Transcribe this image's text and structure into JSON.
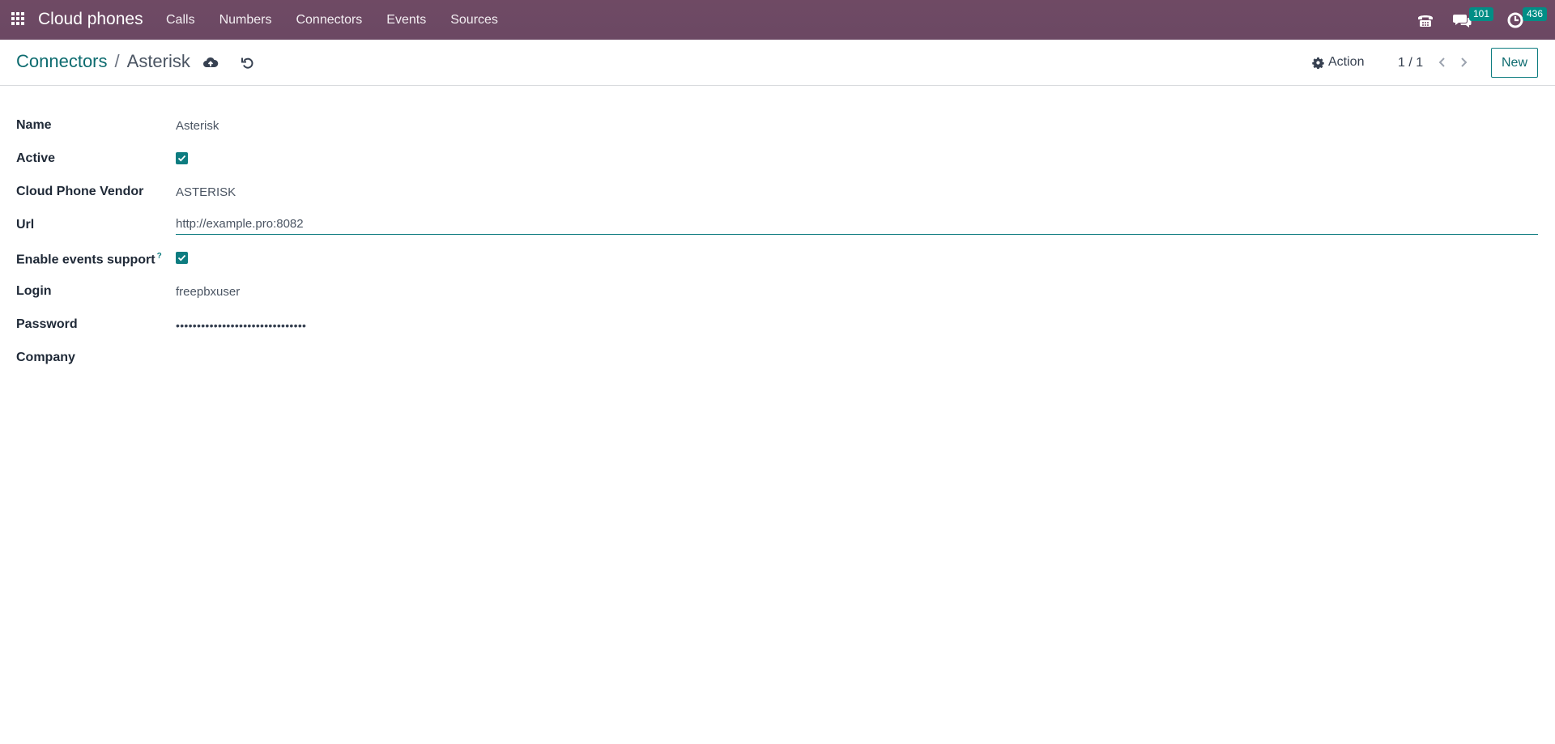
{
  "navbar": {
    "brand": "Cloud phones",
    "menu": [
      {
        "label": "Calls"
      },
      {
        "label": "Numbers"
      },
      {
        "label": "Connectors"
      },
      {
        "label": "Events"
      },
      {
        "label": "Sources"
      }
    ],
    "messages_count": "101",
    "activities_count": "436"
  },
  "breadcrumb": {
    "parent": "Connectors",
    "separator": "/",
    "current": "Asterisk"
  },
  "control_panel": {
    "action_label": "Action",
    "pager_value": "1 / 1",
    "new_label": "New"
  },
  "form": {
    "name": {
      "label": "Name",
      "value": "Asterisk"
    },
    "active": {
      "label": "Active",
      "checked": true
    },
    "vendor": {
      "label": "Cloud Phone Vendor",
      "value": "ASTERISK"
    },
    "url": {
      "label": "Url",
      "value": "http://example.pro:8082"
    },
    "events_support": {
      "label": "Enable events support",
      "tooltip_mark": "?",
      "checked": true
    },
    "login": {
      "label": "Login",
      "value": "freepbxuser"
    },
    "password": {
      "label": "Password",
      "value": "•••••••••••••••••••••••••••••••"
    },
    "company": {
      "label": "Company",
      "value": ""
    }
  },
  "colors": {
    "navbar": "#714b67",
    "accent": "#0d7c80",
    "badge": "#018e86"
  }
}
